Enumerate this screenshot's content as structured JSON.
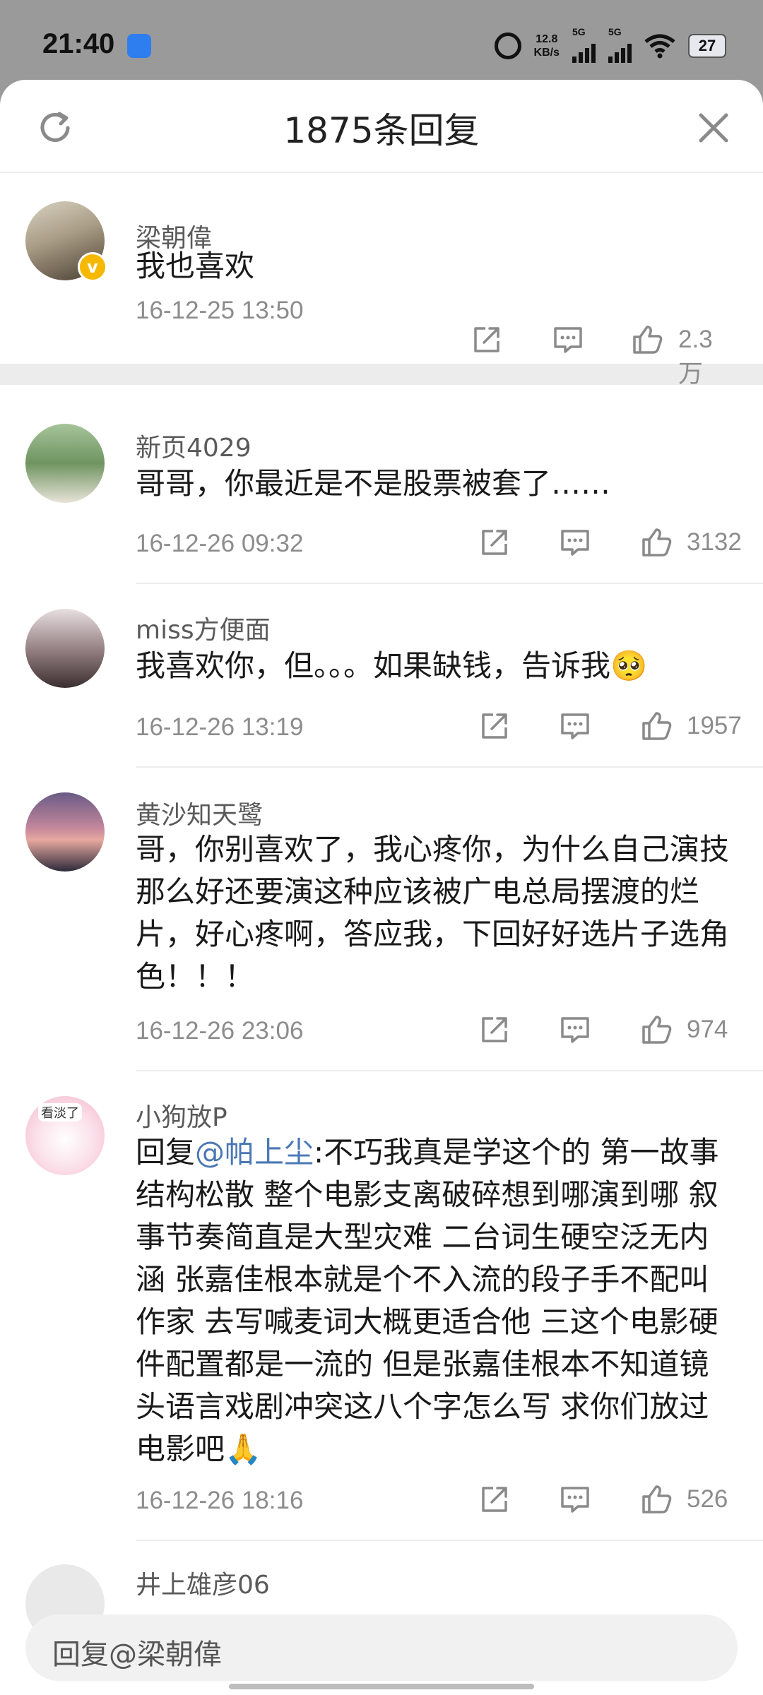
{
  "status_bar": {
    "time": "21:40",
    "speed_value": "12.8",
    "speed_unit": "KB/s",
    "signal1_label": "5G",
    "signal2_label": "5G",
    "battery": "27"
  },
  "header": {
    "title": "1875条回复"
  },
  "main_comment": {
    "user": "梁朝偉",
    "text": "我也喜欢",
    "time": "16-12-25 13:50",
    "likes": "2.3万",
    "verified_mark": "v"
  },
  "replies": [
    {
      "user": "新页4029",
      "text": "哥哥，你最近是不是股票被套了……",
      "time": "16-12-26 09:32",
      "likes": "3132"
    },
    {
      "user": "miss方便面",
      "text": "我喜欢你，但。。。如果缺钱，告诉我",
      "emoji": "🥺",
      "time": "16-12-26 13:19",
      "likes": "1957"
    },
    {
      "user": "黄沙知天鹭",
      "text": "哥，你别喜欢了，我心疼你，为什么自己演技那么好还要演这种应该被广电总局摆渡的烂片，好心疼啊，答应我，下回好好选片子选角色！！！",
      "time": "16-12-26 23:06",
      "likes": "974"
    },
    {
      "user": "小狗放P",
      "reply_prefix": "回复",
      "mention": "@帕上尘",
      "text": ":不巧我真是学这个的 第一故事结构松散 整个电影支离破碎想到哪演到哪 叙事节奏简直是大型灾难 二台词生硬空泛无内涵 张嘉佳根本就是个不入流的段子手不配叫作家 去写喊麦词大概更适合他 三这个电影硬件配置都是一流的 但是张嘉佳根本不知道镜头语言戏剧冲突这八个字怎么写 求你们放过电影吧",
      "emoji": "🙏",
      "avatar_badge": "看淡了",
      "time": "16-12-26 18:16",
      "likes": "526"
    },
    {
      "user": "井上雄彦06"
    }
  ],
  "input": {
    "placeholder": "回复@梁朝偉"
  },
  "icons": {
    "refresh": "refresh-icon",
    "close": "close-icon",
    "share": "share-icon",
    "comment": "comment-icon",
    "like": "thumbs-up-icon"
  },
  "colors": {
    "mention": "#4a78b4",
    "secondary_text": "#8c8c8c",
    "verified": "#f6b800"
  }
}
